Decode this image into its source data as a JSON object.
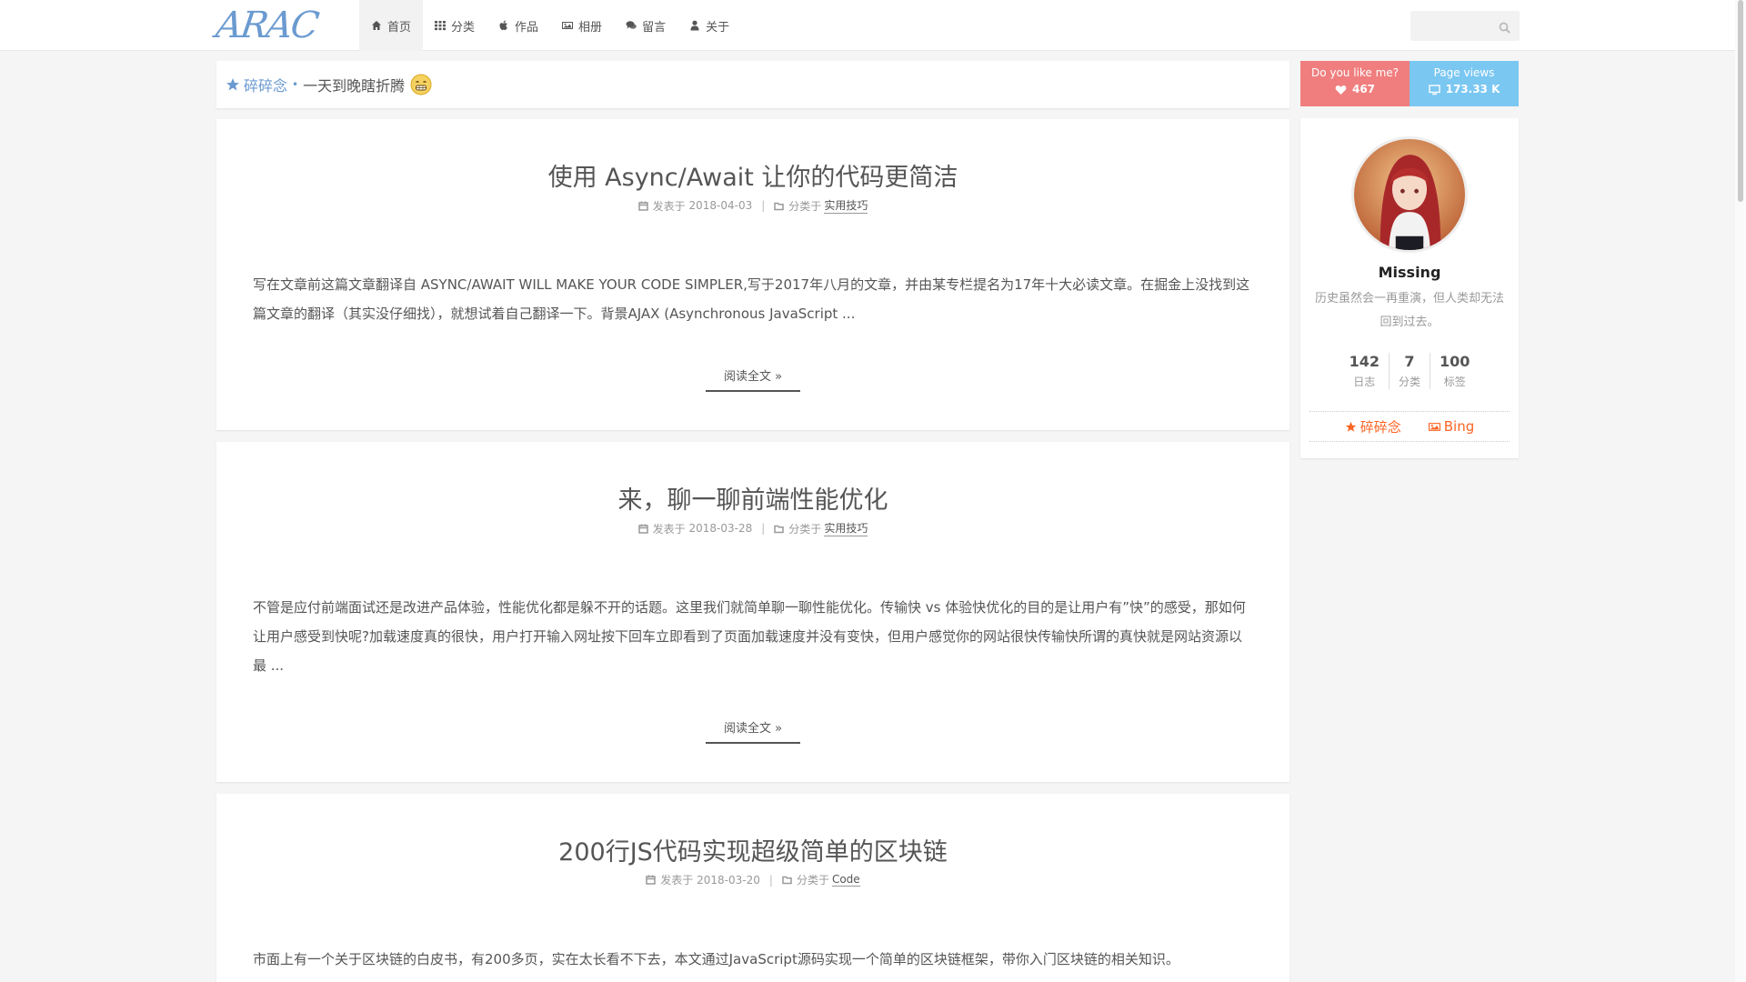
{
  "header": {
    "logo_text": "ARAC",
    "nav": [
      {
        "label": "首页",
        "icon": "home-icon",
        "active": true
      },
      {
        "label": "分类",
        "icon": "grid-icon",
        "active": false
      },
      {
        "label": "作品",
        "icon": "apple-icon",
        "active": false
      },
      {
        "label": "相册",
        "icon": "image-icon",
        "active": false
      },
      {
        "label": "留言",
        "icon": "comments-icon",
        "active": false
      },
      {
        "label": "关于",
        "icon": "user-icon",
        "active": false
      }
    ],
    "search_placeholder": ""
  },
  "motto": {
    "label": "碎碎念",
    "dot": "•",
    "text": "一天到晚瞎折腾"
  },
  "posts": [
    {
      "title": "使用 Async/Await 让你的代码更简洁",
      "date_prefix": "发表于",
      "date": "2018-04-03",
      "cat_prefix": "分类于",
      "category": "实用技巧",
      "excerpt": "写在文章前这篇文章翻译自 ASYNC/AWAIT WILL MAKE YOUR CODE SIMPLER,写于2017年八月的文章，并由某专栏提名为17年十大必读文章。在掘金上没找到这篇文章的翻译（其实没仔细找），就想试着自己翻译一下。背景AJAX (Asynchronous JavaScript ...",
      "read_more": "阅读全文 »"
    },
    {
      "title": "来，聊一聊前端性能优化",
      "date_prefix": "发表于",
      "date": "2018-03-28",
      "cat_prefix": "分类于",
      "category": "实用技巧",
      "excerpt": "不管是应付前端面试还是改进产品体验，性能优化都是躲不开的话题。这里我们就简单聊一聊性能优化。传输快 vs 体验快优化的目的是让用户有”快”的感受，那如何让用户感受到快呢?加载速度真的很快，用户打开输入网址按下回车立即看到了页面加载速度并没有变快，但用户感觉你的网站很快传输快所谓的真快就是网站资源以最 ...",
      "read_more": "阅读全文 »"
    },
    {
      "title": "200行JS代码实现超级简单的区块链",
      "date_prefix": "发表于",
      "date": "2018-03-20",
      "cat_prefix": "分类于",
      "category": "Code",
      "excerpt": "市面上有一个关于区块链的白皮书，有200多页，实在太长看不下去，本文通过JavaScript源码实现一个简单的区块链框架，带你入门区块链的相关知识。",
      "read_more": ""
    }
  ],
  "sidebar": {
    "like": {
      "label": "Do you like me?",
      "value": "467"
    },
    "views": {
      "label": "Page views",
      "value": "173.33 K"
    },
    "author": {
      "name": "Missing",
      "description": "历史虽然会一再重演，但人类却无法回到过去。"
    },
    "counts": [
      {
        "num": "142",
        "label": "日志"
      },
      {
        "num": "7",
        "label": "分类"
      },
      {
        "num": "100",
        "label": "标签"
      }
    ],
    "links": [
      {
        "label": "碎碎念",
        "icon": "star-icon"
      },
      {
        "label": "Bing",
        "icon": "image-icon"
      }
    ]
  },
  "colors": {
    "accent_blue": "#6a9ad0",
    "like_bg": "#f07e7e",
    "views_bg": "#7ac7f2",
    "link_orange": "#fc6423"
  }
}
